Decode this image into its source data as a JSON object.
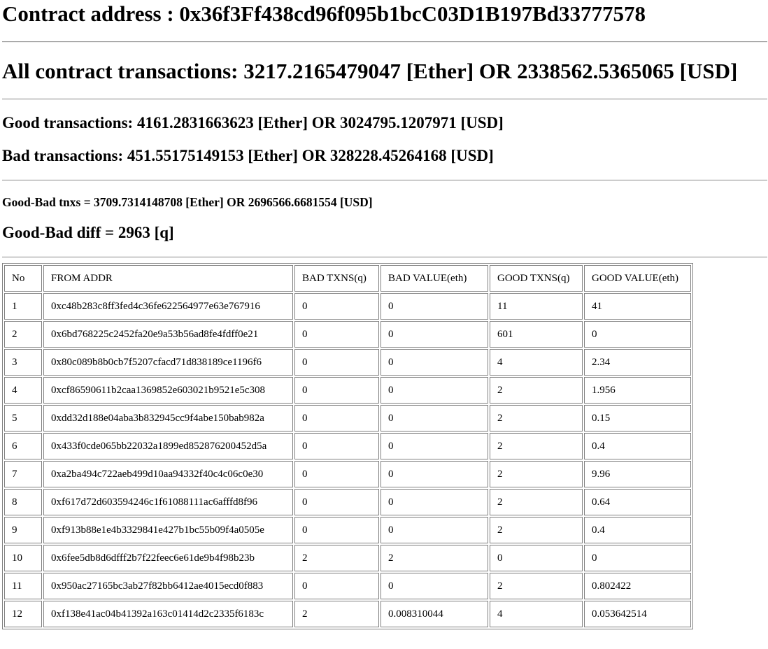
{
  "header": {
    "contract_address": "Contract address : 0x36f3Ff438cd96f095b1bcC03D1B197Bd33777578",
    "all_transactions": "All contract transactions: 3217.2165479047 [Ether] OR 2338562.5365065 [USD]",
    "good_transactions": "Good transactions: 4161.2831663623 [Ether] OR 3024795.1207971 [USD]",
    "bad_transactions": "Bad transactions: 451.55175149153 [Ether] OR 328228.45264168 [USD]",
    "good_bad_tnxs": "Good-Bad tnxs = 3709.7314148708 [Ether] OR 2696566.6681554 [USD]",
    "good_bad_diff": "Good-Bad diff = 2963 [q]"
  },
  "table": {
    "columns": [
      "No",
      "FROM ADDR",
      "BAD TXNS(q)",
      "BAD VALUE(eth)",
      "GOOD TXNS(q)",
      "GOOD VALUE(eth)"
    ],
    "rows": [
      [
        "1",
        "0xc48b283c8ff3fed4c36fe622564977e63e767916",
        "0",
        "0",
        "11",
        "41"
      ],
      [
        "2",
        "0x6bd768225c2452fa20e9a53b56ad8fe4fdff0e21",
        "0",
        "0",
        "601",
        "0"
      ],
      [
        "3",
        "0x80c089b8b0cb7f5207cfacd71d838189ce1196f6",
        "0",
        "0",
        "4",
        "2.34"
      ],
      [
        "4",
        "0xcf86590611b2caa1369852e603021b9521e5c308",
        "0",
        "0",
        "2",
        "1.956"
      ],
      [
        "5",
        "0xdd32d188e04aba3b832945cc9f4abe150bab982a",
        "0",
        "0",
        "2",
        "0.15"
      ],
      [
        "6",
        "0x433f0cde065bb22032a1899ed852876200452d5a",
        "0",
        "0",
        "2",
        "0.4"
      ],
      [
        "7",
        "0xa2ba494c722aeb499d10aa94332f40c4c06c0e30",
        "0",
        "0",
        "2",
        "9.96"
      ],
      [
        "8",
        "0xf617d72d603594246c1f61088111ac6afffd8f96",
        "0",
        "0",
        "2",
        "0.64"
      ],
      [
        "9",
        "0xf913b88e1e4b3329841e427b1bc55b09f4a0505e",
        "0",
        "0",
        "2",
        "0.4"
      ],
      [
        "10",
        "0x6fee5db8d6dfff2b7f22feec6e61de9b4f98b23b",
        "2",
        "2",
        "0",
        "0"
      ],
      [
        "11",
        "0x950ac27165bc3ab27f82bb6412ae4015ecd0f883",
        "0",
        "0",
        "2",
        "0.802422"
      ],
      [
        "12",
        "0xf138e41ac04b41392a163c01414d2c2335f6183c",
        "2",
        "0.008310044",
        "4",
        "0.053642514"
      ]
    ]
  }
}
